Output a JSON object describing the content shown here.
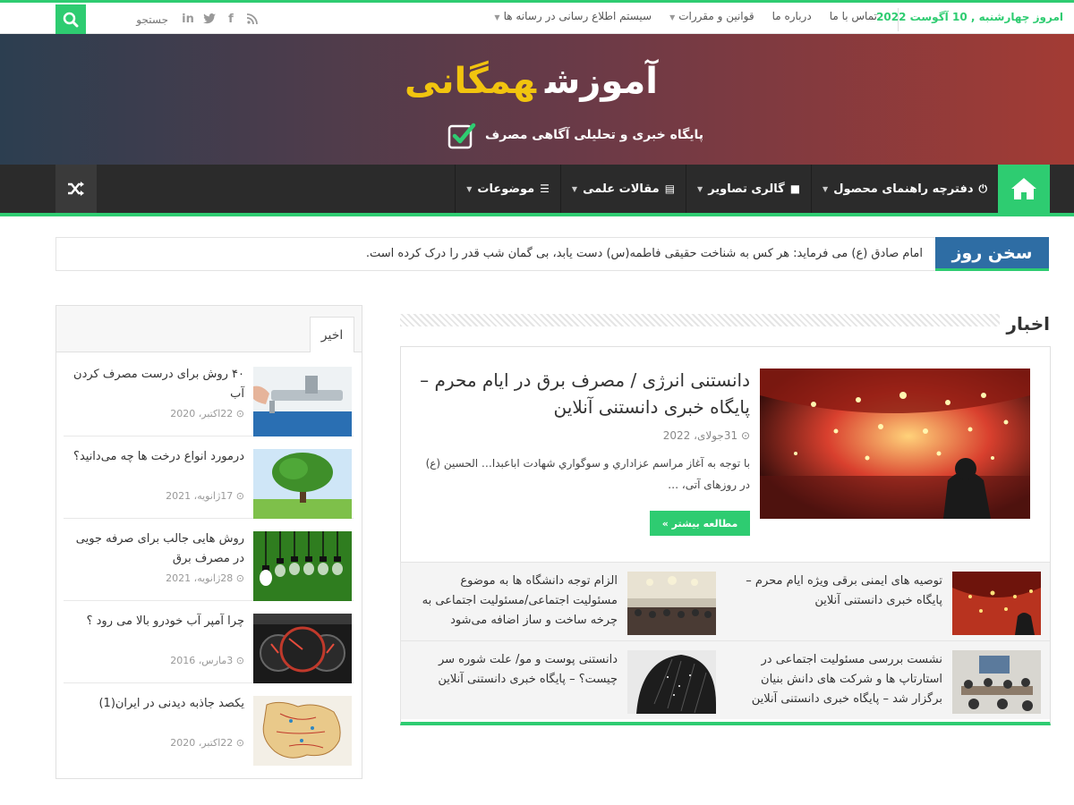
{
  "topbar": {
    "date": "امروز چهارشنبه , 10 آگوست 2022",
    "nav": [
      {
        "label": "سیستم اطلاع رسانی در رسانه ها",
        "dropdown": true
      },
      {
        "label": "قوانین و مقررات",
        "dropdown": true
      },
      {
        "label": "درباره ما",
        "dropdown": false
      },
      {
        "label": "تماس با ما",
        "dropdown": false
      }
    ],
    "search_placeholder": "جستجو",
    "socials": [
      "rss-icon",
      "facebook-icon",
      "twitter-icon",
      "linkedin-icon"
    ]
  },
  "header": {
    "logo_word1": "آموزش",
    "logo_word2": "همگانی",
    "tagline": "پایگاه خبری و تحلیلی آگاهی مصرف"
  },
  "mainnav": [
    {
      "label": "موضوعات",
      "icon": "list-icon"
    },
    {
      "label": "مقالات علمی",
      "icon": "book-icon"
    },
    {
      "label": "گالری تصاویر",
      "icon": "video-camera-icon"
    },
    {
      "label": "دفترچه راهنمای محصول",
      "icon": "power-icon"
    }
  ],
  "quote": {
    "label": "سخن روز",
    "text": "امام صادق (ع) می فرمايد: هر کس به شناخت حقيقی فاطمه(س) دست يابد، بی گمان شب قدر را درک کرده است."
  },
  "news": {
    "section_title": "اخبار",
    "featured": {
      "title": "دانستنی انرژی / مصرف برق در ایام محرم – پایگاه خبری دانستنی آنلاین",
      "date": "31جولای، 2022",
      "excerpt": "با توجه به آغاز مراسم عزاداري و سوگواري شهادت اباعبدا… الحسين (ع) در روزهای آتی، …",
      "more": "مطالعه بیشتر »"
    },
    "items": [
      {
        "title": "توصیه های ایمنی برقی ویژه ایام محرم – پایگاه خبری دانستنی آنلاین"
      },
      {
        "title": "الزام توجه دانشگاه ها به موضوع مسئولیت اجتماعی/مسئولیت اجتماعی به چرخه ساخت و ساز اضافه می‌شود"
      },
      {
        "title": "نشست بررسی مسئولیت اجتماعی در استارتاپ ها و شرکت های دانش بنیان برگزار شد – پایگاه خبری دانستنی آنلاین"
      },
      {
        "title": "دانستنی پوست و مو/ علت شوره سر چیست؟ – پایگاه خبری دانستنی آنلاین"
      }
    ]
  },
  "sidebar": {
    "tab": "اخیر",
    "items": [
      {
        "title": "۴۰ روش برای درست مصرف کردن آب",
        "date": "22اکتبر، 2020"
      },
      {
        "title": "درمورد انواع درخت ها چه می‌دانید؟",
        "date": "17ژانویه، 2021"
      },
      {
        "title": "روش هایی جالب برای صرفه جویی در مصرف برق",
        "date": "28ژانویه، 2021"
      },
      {
        "title": "چرا آمپر آب خودرو بالا می رود ؟",
        "date": "3مارس، 2016"
      },
      {
        "title": "یکصد جاذبه دیدنی در ایران(1)",
        "date": "22اکتبر، 2020"
      }
    ]
  },
  "colors": {
    "accent": "#2ecc71",
    "quote_label": "#2e6da4",
    "logo_yellow": "#f1c40f"
  }
}
